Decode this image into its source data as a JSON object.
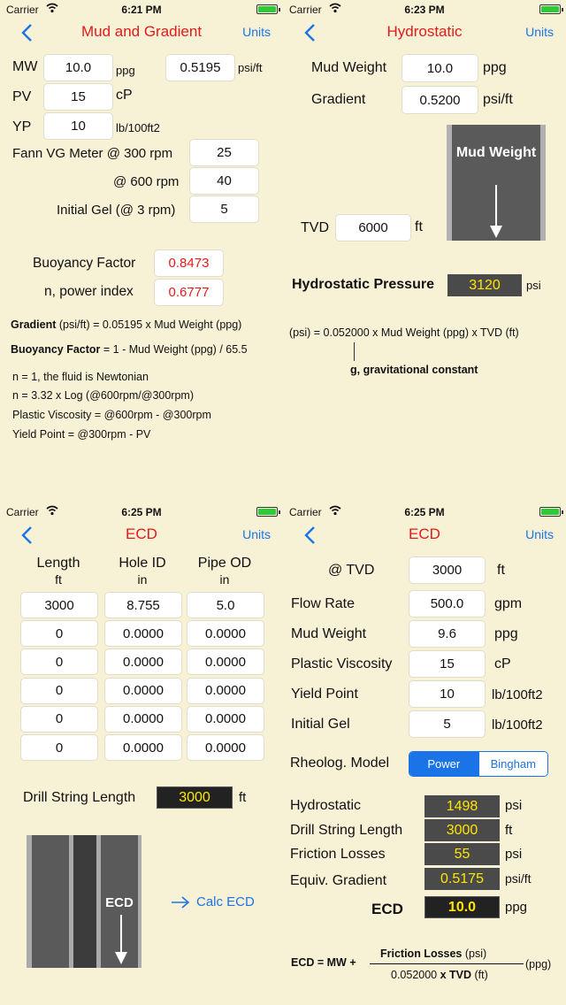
{
  "status": {
    "carrier": "Carrier",
    "times": [
      "6:21 PM",
      "6:23 PM",
      "6:25 PM",
      "6:25 PM"
    ]
  },
  "colors": {
    "accent_blue": "#1a74e8",
    "title_red": "#e21a1a",
    "background": "#f7f1d6",
    "display_yellow": "#ffe600"
  },
  "p1": {
    "title": "Mud and Gradient",
    "units": "Units",
    "mw_label": "MW",
    "mw_value": "10.0",
    "mw_unit": "ppg",
    "grad_value": "0.5195",
    "grad_unit": "psi/ft",
    "pv_label": "PV",
    "pv_value": "15",
    "pv_unit": "cP",
    "yp_label": "YP",
    "yp_value": "10",
    "yp_unit": "lb/100ft2",
    "fann300_label": "Fann VG Meter @ 300 rpm",
    "fann300_value": "25",
    "fann600_label": "@ 600 rpm",
    "fann600_value": "40",
    "gel_label": "Initial Gel (@ 3 rpm)",
    "gel_value": "5",
    "bf_label": "Buoyancy Factor",
    "bf_value": "0.8473",
    "n_label": "n, power index",
    "n_value": "0.6777",
    "f1_bold": "Gradient",
    "f1_rest": " (psi/ft) = 0.05195 x Mud Weight (ppg)",
    "f2_bold": "Buoyancy Factor",
    "f2_rest": " = 1 - Mud Weight (ppg) / 65.5",
    "notes": [
      "n = 1, the fluid is Newtonian",
      "n = 3.32 x Log (@600rpm/@300rpm)",
      "Plastic Viscosity = @600rpm - @300rpm",
      "Yield Point = @300rpm - PV"
    ]
  },
  "p2": {
    "title": "Hydrostatic",
    "units": "Units",
    "mw_label": "Mud Weight",
    "mw_value": "10.0",
    "mw_unit": "ppg",
    "grad_label": "Gradient",
    "grad_value": "0.5200",
    "grad_unit": "psi/ft",
    "diagram_label": "Mud Weight",
    "tvd_label": "TVD",
    "tvd_value": "6000",
    "tvd_unit": "ft",
    "hp_label": "Hydrostatic Pressure",
    "hp_value": "3120",
    "hp_unit": "psi",
    "formula": "(psi) = 0.052000 x Mud Weight (ppg) x TVD (ft)",
    "g_note": "g, gravitational constant"
  },
  "p3": {
    "title": "ECD",
    "units": "Units",
    "headers": [
      {
        "name": "Length",
        "unit": "ft"
      },
      {
        "name": "Hole ID",
        "unit": "in"
      },
      {
        "name": "Pipe OD",
        "unit": "in"
      }
    ],
    "rows": [
      [
        "3000",
        "8.755",
        "5.0"
      ],
      [
        "0",
        "0.0000",
        "0.0000"
      ],
      [
        "0",
        "0.0000",
        "0.0000"
      ],
      [
        "0",
        "0.0000",
        "0.0000"
      ],
      [
        "0",
        "0.0000",
        "0.0000"
      ],
      [
        "0",
        "0.0000",
        "0.0000"
      ]
    ],
    "dsl_label": "Drill String Length",
    "dsl_value": "3000",
    "dsl_unit": "ft",
    "diagram_label": "ECD",
    "calc_label": "Calc ECD"
  },
  "p4": {
    "title": "ECD",
    "units": "Units",
    "tvd_label": "@ TVD",
    "tvd_value": "3000",
    "tvd_unit": "ft",
    "flow_label": "Flow Rate",
    "flow_value": "500.0",
    "flow_unit": "gpm",
    "mw_label": "Mud Weight",
    "mw_value": "9.6",
    "mw_unit": "ppg",
    "pv_label": "Plastic Viscosity",
    "pv_value": "15",
    "pv_unit": "cP",
    "yp_label": "Yield Point",
    "yp_value": "10",
    "yp_unit": "lb/100ft2",
    "gel_label": "Initial Gel",
    "gel_value": "5",
    "gel_unit": "lb/100ft2",
    "model_label": "Rheolog. Model",
    "model_power": "Power",
    "model_bingham": "Bingham",
    "hyd_label": "Hydrostatic",
    "hyd_value": "1498",
    "hyd_unit": "psi",
    "dsl_label": "Drill String Length",
    "dsl_value": "3000",
    "dsl_unit": "ft",
    "fl_label": "Friction Losses",
    "fl_value": "55",
    "fl_unit": "psi",
    "eg_label": "Equiv. Gradient",
    "eg_value": "0.5175",
    "eg_unit": "psi/ft",
    "ecd_label": "ECD",
    "ecd_value": "10.0",
    "ecd_unit": "ppg",
    "f_left": "ECD = MW +",
    "f_num_bold": "Friction Losses",
    "f_num_rest": " (psi)",
    "f_den_a": "0.052000 ",
    "f_den_bold": "x TVD",
    "f_den_rest": " (ft)",
    "f_right": "(ppg)"
  }
}
